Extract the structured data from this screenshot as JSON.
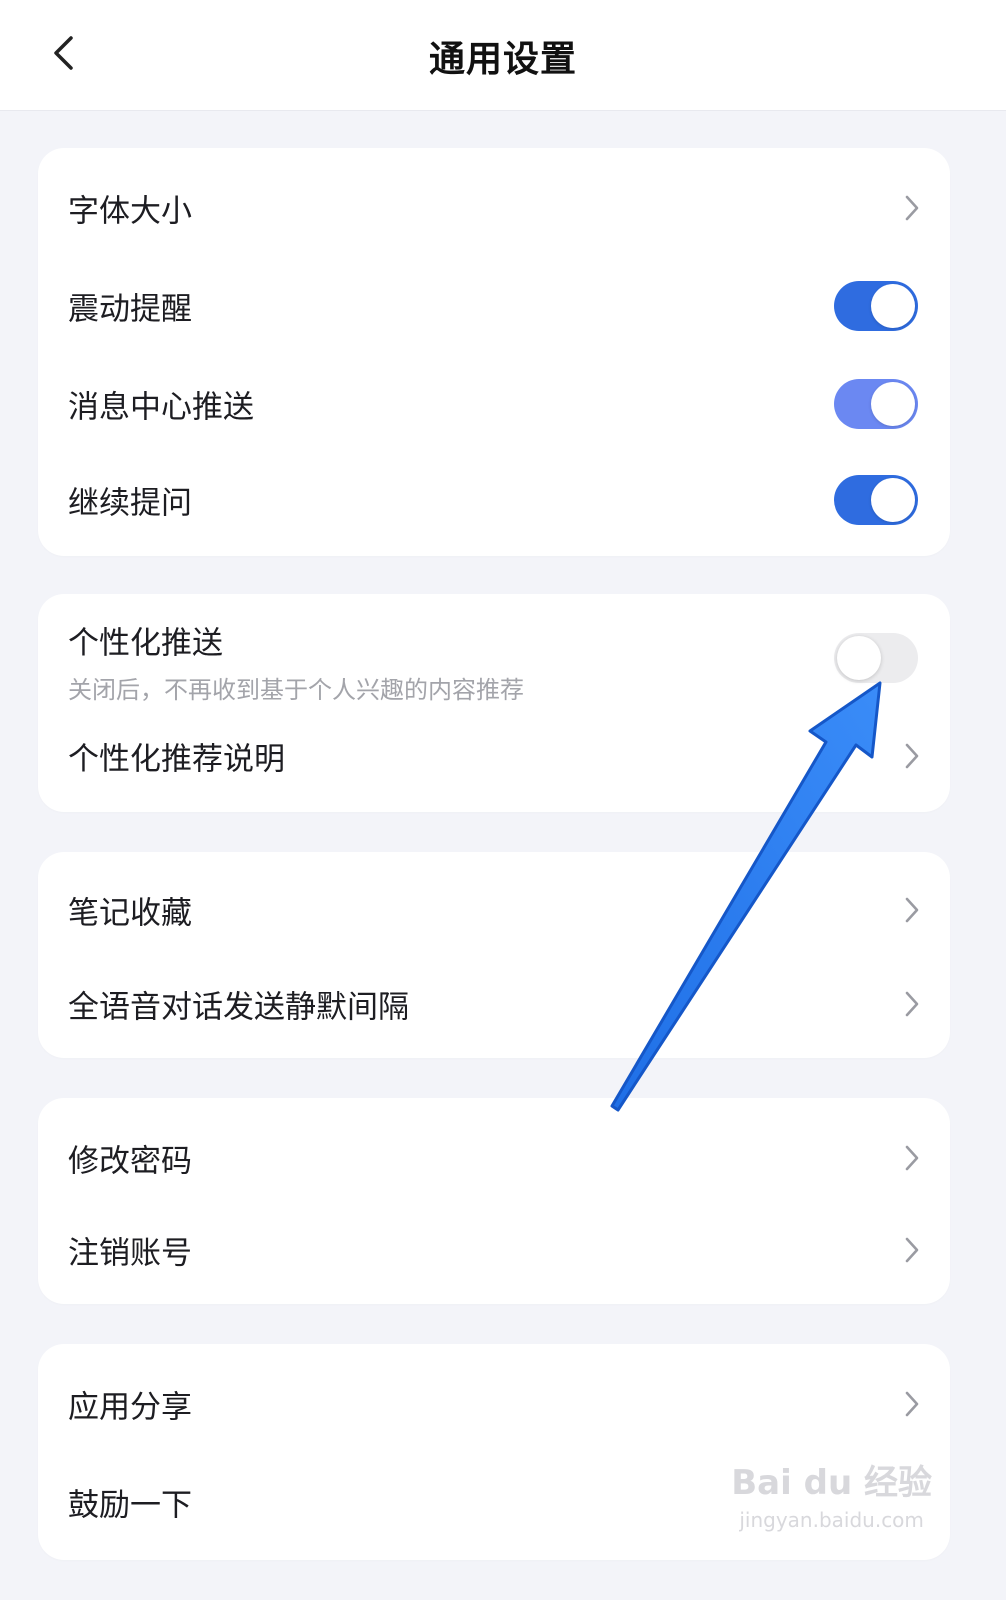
{
  "header": {
    "title": "通用设置"
  },
  "groups": [
    {
      "items": [
        {
          "label": "字体大小",
          "control": "chevron"
        },
        {
          "label": "震动提醒",
          "control": "toggle",
          "on": true
        },
        {
          "label": "消息中心推送",
          "control": "toggle",
          "on": true
        },
        {
          "label": "继续提问",
          "control": "toggle",
          "on": true
        }
      ]
    },
    {
      "items": [
        {
          "label": "个性化推送",
          "control": "toggle",
          "on": false,
          "description": "关闭后，不再收到基于个人兴趣的内容推荐"
        },
        {
          "label": "个性化推荐说明",
          "control": "chevron"
        }
      ]
    },
    {
      "items": [
        {
          "label": "笔记收藏",
          "control": "chevron"
        },
        {
          "label": "全语音对话发送静默间隔",
          "control": "chevron"
        }
      ]
    },
    {
      "items": [
        {
          "label": "修改密码",
          "control": "chevron"
        },
        {
          "label": "注销账号",
          "control": "chevron"
        }
      ]
    },
    {
      "items": [
        {
          "label": "应用分享",
          "control": "chevron"
        },
        {
          "label": "鼓励一下",
          "control": "chevron"
        }
      ]
    }
  ],
  "watermark": {
    "brand": "Bai du 经验",
    "url": "jingyan.baidu.com"
  },
  "colors": {
    "toggle_on": "#2f6ce0",
    "toggle_off": "#ececee",
    "annotation_arrow": "#2b7cf0"
  }
}
